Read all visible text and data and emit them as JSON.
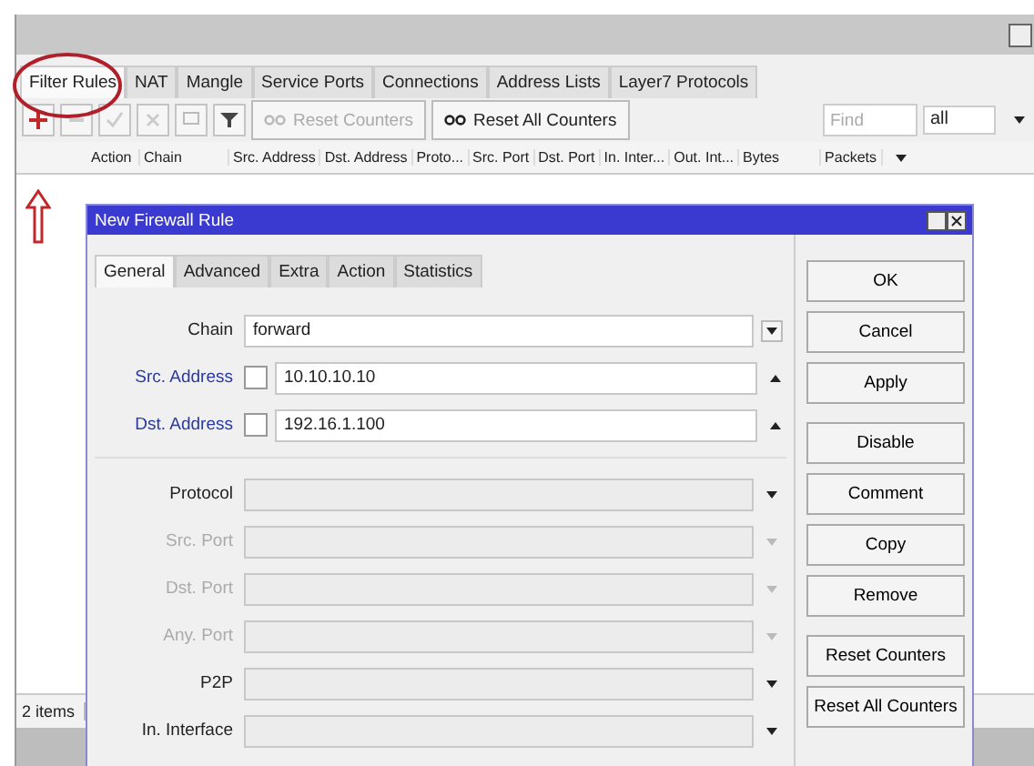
{
  "window": {
    "tabs": [
      {
        "label": "Filter Rules",
        "selected": true
      },
      {
        "label": "NAT",
        "selected": false
      },
      {
        "label": "Mangle",
        "selected": false
      },
      {
        "label": "Service Ports",
        "selected": false
      },
      {
        "label": "Connections",
        "selected": false
      },
      {
        "label": "Address Lists",
        "selected": false
      },
      {
        "label": "Layer7 Protocols",
        "selected": false
      }
    ]
  },
  "toolbar": {
    "buttons": [
      {
        "label": "Reset Counters",
        "disabled": true
      },
      {
        "label": "Reset All Counters",
        "disabled": false
      }
    ],
    "find": {
      "placeholder": "Find"
    },
    "filter": {
      "value": "all"
    }
  },
  "table": {
    "columns": [
      "Action",
      "Chain",
      "Src. Address",
      "Dst. Address",
      "Proto...",
      "Src. Port",
      "Dst. Port",
      "In. Inter...",
      "Out. Int...",
      "Bytes",
      "Packets"
    ]
  },
  "status_bar": "2 items",
  "dialog": {
    "title": "New Firewall Rule",
    "tabs": [
      {
        "label": "General",
        "selected": true
      },
      {
        "label": "Advanced",
        "selected": false
      },
      {
        "label": "Extra",
        "selected": false
      },
      {
        "label": "Action",
        "selected": false
      },
      {
        "label": "Statistics",
        "selected": false
      }
    ],
    "sections": [
      {
        "fields": [
          {
            "label": "Chain",
            "kind": "combo",
            "value": "forward",
            "disabled": false
          },
          {
            "label": "Src. Address",
            "kind": "address",
            "value": "10.10.10.10",
            "checked": false
          },
          {
            "label": "Dst. Address",
            "kind": "address",
            "value": "192.16.1.100",
            "checked": false
          }
        ]
      },
      {
        "fields": [
          {
            "label": "Protocol",
            "kind": "combo",
            "disabled": false
          },
          {
            "label": "Src. Port",
            "kind": "combo",
            "disabled": true
          },
          {
            "label": "Dst. Port",
            "kind": "combo",
            "disabled": true
          },
          {
            "label": "Any. Port",
            "kind": "combo",
            "disabled": true
          },
          {
            "label": "P2P",
            "kind": "combo",
            "disabled": false
          },
          {
            "label": "In. Interface",
            "kind": "combo",
            "disabled": false
          }
        ]
      }
    ],
    "button_groups": [
      {
        "buttons": [
          "OK",
          "Cancel",
          "Apply"
        ]
      },
      {
        "buttons": [
          "Disable",
          "Comment",
          "Copy",
          "Remove"
        ]
      },
      {
        "buttons": [
          "Reset Counters",
          "Reset All Counters"
        ]
      }
    ]
  }
}
